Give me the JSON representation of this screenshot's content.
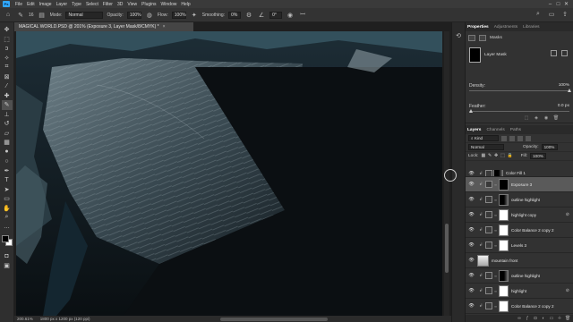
{
  "app": {
    "logo": "Ps"
  },
  "menu": [
    "File",
    "Edit",
    "Image",
    "Layer",
    "Type",
    "Select",
    "Filter",
    "3D",
    "View",
    "Plugins",
    "Window",
    "Help"
  ],
  "window_controls": [
    "–",
    "□",
    "✕"
  ],
  "options": {
    "brush_size": "16",
    "mode_label": "Mode:",
    "mode_value": "Normal",
    "opacity_label": "Opacity:",
    "opacity_value": "100%",
    "flow_label": "Flow:",
    "flow_value": "100%",
    "smoothing_label": "Smoothing:",
    "smoothing_value": "0%",
    "angle_value": "0°"
  },
  "document": {
    "tab_title": "MAGICAL WORLD.PSD @ 201% (Exposure 3, Layer Mask/8/CMYK) *",
    "tab_close": "×",
    "zoom": "200.61%",
    "doc_info": "1800 px x 1200 px (120 ppi)"
  },
  "properties": {
    "tabs": [
      "Properties",
      "Adjustments",
      "Libraries"
    ],
    "active_tab": "Properties",
    "section_label": "Masks",
    "layer_mask_label": "Layer Mask",
    "density_label": "Density:",
    "density_value": "100%",
    "density_level": 1.0,
    "feather_label": "Feather:",
    "feather_value": "0.0 px",
    "feather_level": 0.0
  },
  "layers_panel": {
    "tabs": [
      "Layers",
      "Channels",
      "Paths"
    ],
    "active_tab": "Layers",
    "kind_label": "Kind",
    "blend_mode": "Normal",
    "opacity_label": "Opacity:",
    "opacity_value": "100%",
    "lock_label": "Lock:",
    "fill_label": "Fill:",
    "fill_value": "100%",
    "layers": [
      {
        "name": "Color Fill 1",
        "mask": "dark",
        "active": false,
        "fx": ""
      },
      {
        "name": "Exposure 3",
        "mask": "black",
        "active": true,
        "fx": ""
      },
      {
        "name": "outline highlight",
        "mask": "dark",
        "active": false,
        "fx": ""
      },
      {
        "name": "highlight copy",
        "mask": "white",
        "active": false,
        "fx": "⊘"
      },
      {
        "name": "Color Balance 2 copy 2",
        "mask": "white",
        "active": false,
        "fx": ""
      },
      {
        "name": "Levels 3",
        "mask": "white",
        "active": false,
        "fx": ""
      },
      {
        "name": "mountain front",
        "mask": "image",
        "active": false,
        "fx": ""
      },
      {
        "name": "outline highlight",
        "mask": "dark",
        "active": false,
        "fx": ""
      },
      {
        "name": "highlight",
        "mask": "white",
        "active": false,
        "fx": "⊘"
      },
      {
        "name": "Color Balance 2 copy 2",
        "mask": "white",
        "active": false,
        "fx": ""
      }
    ]
  },
  "colors": {
    "app_bg": "#2b2b2b",
    "accent": "#31a8ff",
    "selected_layer": "#5a5a5a"
  },
  "icons": {
    "toolbar": [
      "move-icon",
      "marquee-icon",
      "lasso-icon",
      "quick-select-icon",
      "crop-icon",
      "frame-icon",
      "eyedropper-icon",
      "healing-icon",
      "brush-icon",
      "clone-stamp-icon",
      "history-brush-icon",
      "eraser-icon",
      "gradient-icon",
      "blur-icon",
      "dodge-icon",
      "pen-icon",
      "type-icon",
      "path-select-icon",
      "rectangle-icon",
      "hand-icon",
      "zoom-icon",
      "more-tools-icon"
    ]
  }
}
